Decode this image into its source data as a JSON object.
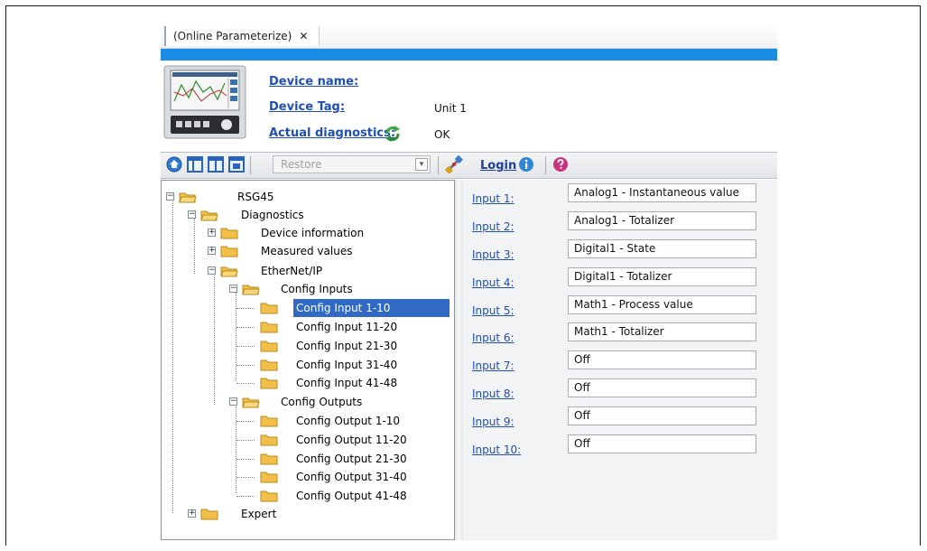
{
  "tab": {
    "title": "(Online Parameterize)",
    "close": "✕"
  },
  "device": {
    "name_label": "Device name:",
    "name_value": "",
    "tag_label": "Device Tag:",
    "tag_value": "Unit 1",
    "diag_label": "Actual diagnostics:",
    "diag_value": "OK"
  },
  "toolbar": {
    "restore_placeholder": "Restore",
    "login_label": "Login",
    "icons": [
      "home-icon",
      "layout-view-1-icon",
      "layout-view-2-icon",
      "layout-view-3-icon",
      "dropdown-arrow-icon",
      "connect-icon",
      "info-icon",
      "help-icon"
    ]
  },
  "tree": {
    "root": "RSG45",
    "diagnostics": "Diagnostics",
    "device_information": "Device information",
    "measured_values": "Measured values",
    "ethernet_ip": "EtherNet/IP",
    "config_inputs": "Config Inputs",
    "inputs": [
      "Config Input 1-10",
      "Config Input 11-20",
      "Config Input 21-30",
      "Config Input 31-40",
      "Config Input 41-48"
    ],
    "config_outputs": "Config Outputs",
    "outputs": [
      "Config Output 1-10",
      "Config Output 11-20",
      "Config Output 21-30",
      "Config Output 31-40",
      "Config Output 41-48"
    ],
    "expert": "Expert",
    "selected": "Config Input 1-10"
  },
  "params": [
    {
      "label": "Input 1:",
      "value": "Analog1 - Instantaneous value"
    },
    {
      "label": "Input 2:",
      "value": "Analog1 - Totalizer"
    },
    {
      "label": "Input 3:",
      "value": "Digital1 - State"
    },
    {
      "label": "Input 4:",
      "value": "Digital1 - Totalizer"
    },
    {
      "label": "Input 5:",
      "value": "Math1 - Process value"
    },
    {
      "label": "Input 6:",
      "value": "Math1 - Totalizer"
    },
    {
      "label": "Input 7:",
      "value": "Off"
    },
    {
      "label": "Input 8:",
      "value": "Off"
    },
    {
      "label": "Input 9:",
      "value": "Off"
    },
    {
      "label": "Input 10:",
      "value": "Off"
    }
  ],
  "colors": {
    "accent_bar": "#1b8ce3",
    "link": "#1f4fb5",
    "selection": "#316ac5",
    "folder": "#f5c542"
  }
}
